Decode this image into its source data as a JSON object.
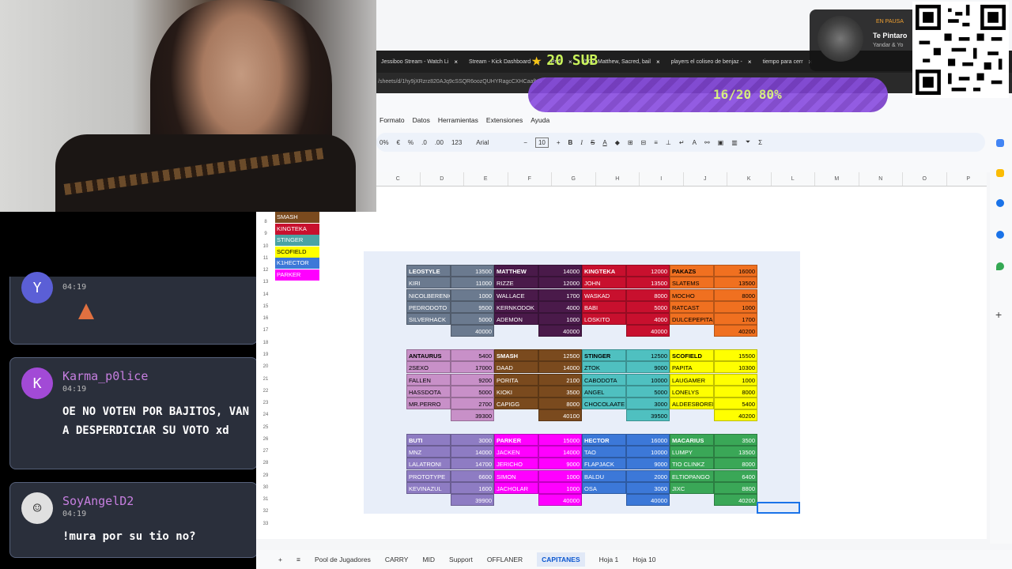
{
  "browser": {
    "tabs": [
      {
        "label": "Jessiboo Stream - Watch Li"
      },
      {
        "label": "Stream - Kick Dashboard"
      },
      {
        "label": "Pro -"
      },
      {
        "label": "(502) Matthew, Sacred, bail"
      },
      {
        "label": "players el coliseo de benjaz -"
      },
      {
        "label": "tiempo para cerr"
      }
    ],
    "url": "/sheets/d/1hy9jXRzrz820AJq9cSSQR6oozQUHYRagcCXHCaafH5"
  },
  "overlay": {
    "sub_goal_label": "20 SUB",
    "sub_progress_text": "16/20 80%",
    "sub_progress": 0.8,
    "music_status": "EN PAUSA",
    "music_title": "Te Pintaro",
    "music_artist": "Yandar & Yo"
  },
  "sheets": {
    "menu": [
      "Formato",
      "Datos",
      "Herramientas",
      "Extensiones",
      "Ayuda"
    ],
    "toolbar": {
      "zoom": "0%",
      "currency": "€",
      "percent": "%",
      "format_123": "123",
      "font": "Arial",
      "font_size": "10"
    },
    "columns": [
      "C",
      "D",
      "E",
      "F",
      "G",
      "H",
      "I",
      "J",
      "K",
      "L",
      "M",
      "N",
      "O",
      "P"
    ],
    "row_numbers": [
      "8",
      "9",
      "10",
      "11",
      "12",
      "13",
      "14",
      "15",
      "16",
      "17",
      "18",
      "19",
      "20",
      "21",
      "22",
      "23",
      "24",
      "25",
      "26",
      "27",
      "28",
      "29",
      "30",
      "31",
      "32",
      "33"
    ],
    "legend": [
      {
        "label": "SMASH",
        "color": "#7a4a1e"
      },
      {
        "label": "KINGTEKA",
        "color": "#c8102e"
      },
      {
        "label": "STINGER",
        "color": "#4aa3a3"
      },
      {
        "label": "SCOFIELD",
        "color": "#ffff00"
      },
      {
        "label": "K1HECTOR",
        "color": "#3c78d8"
      },
      {
        "label": "PARKER",
        "color": "#ff00ff"
      }
    ],
    "teams": [
      {
        "captain": "LEOSTYLE",
        "captain_value": "13500",
        "color": "#6b7a8f",
        "players": [
          [
            "KIRI",
            "11000"
          ],
          [
            "NICOLBERENIC",
            "1000"
          ],
          [
            "PEDRODOTO",
            "9500"
          ],
          [
            "SILVERHACK",
            "5000"
          ]
        ],
        "total": "40000"
      },
      {
        "captain": "MATTHEW",
        "captain_value": "14000",
        "color": "#4a1a4a",
        "players": [
          [
            "RIZZE",
            "12000"
          ],
          [
            "WALLACE",
            "1700"
          ],
          [
            "KERNKODOK",
            "4000"
          ],
          [
            "ADEMON",
            "1000"
          ]
        ],
        "total": "40000"
      },
      {
        "captain": "KINGTEKA",
        "captain_value": "12000",
        "color": "#c8102e",
        "players": [
          [
            "JOHN",
            "13500"
          ],
          [
            "WASKAD",
            "8000"
          ],
          [
            "BABI",
            "5000"
          ],
          [
            "LOSKITO",
            "4000"
          ]
        ],
        "total": "40000"
      },
      {
        "captain": "PAKAZS",
        "captain_value": "16000",
        "color": "#f07020",
        "players": [
          [
            "SLATEMS",
            "13500"
          ],
          [
            "MOCHO",
            "8000"
          ],
          [
            "RATCAST",
            "1000"
          ],
          [
            "DULCEPEPITA",
            "1700"
          ]
        ],
        "total": "40200"
      },
      {
        "captain": "ANTAURUS",
        "captain_value": "5400",
        "color": "#c890c8",
        "players": [
          [
            "2SEXO",
            "17000"
          ],
          [
            "FALLEN",
            "9200"
          ],
          [
            "HASSDOTA",
            "5000"
          ],
          [
            "MR.PERRO",
            "2700"
          ]
        ],
        "total": "39300"
      },
      {
        "captain": "SMASH",
        "captain_value": "12500",
        "color": "#7a4a1e",
        "players": [
          [
            "DAAD",
            "14000"
          ],
          [
            "PORITA",
            "2100"
          ],
          [
            "KIOKI",
            "3500"
          ],
          [
            "CAPIGG",
            "8000"
          ]
        ],
        "total": "40100"
      },
      {
        "captain": "STINGER",
        "captain_value": "12500",
        "color": "#4fc0c0",
        "players": [
          [
            "ZTOK",
            "9000"
          ],
          [
            "CABODOTA",
            "10000"
          ],
          [
            "ANGEL",
            "5000"
          ],
          [
            "CHOCOLAATE",
            "3000"
          ]
        ],
        "total": "39500"
      },
      {
        "captain": "SCOFIELD",
        "captain_value": "15500",
        "color": "#ffff00",
        "players": [
          [
            "PAPITA",
            "10300"
          ],
          [
            "LAUGAMER",
            "1000"
          ],
          [
            "LONELYS",
            "8000"
          ],
          [
            "ALDEESBORED",
            "5400"
          ]
        ],
        "total": "40200"
      },
      {
        "captain": "BUTI",
        "captain_value": "3000",
        "color": "#8e7cc3",
        "players": [
          [
            "MNZ",
            "14000"
          ],
          [
            "LALATRONI",
            "14700"
          ],
          [
            "PROTOTYPE",
            "6600"
          ],
          [
            "KEVINAZUL",
            "1600"
          ]
        ],
        "total": "39900"
      },
      {
        "captain": "PARKER",
        "captain_value": "15000",
        "color": "#ff00ff",
        "players": [
          [
            "JACKEN",
            "14000"
          ],
          [
            "JERICHO",
            "9000"
          ],
          [
            "SIMON",
            "1000"
          ],
          [
            "JACHOLAR",
            "1000"
          ]
        ],
        "total": "40000"
      },
      {
        "captain": "HECTOR",
        "captain_value": "16000",
        "color": "#3c78d8",
        "players": [
          [
            "TAO",
            "10000"
          ],
          [
            "FLAPJACK",
            "9000"
          ],
          [
            "BALDU",
            "2000"
          ],
          [
            "OSA",
            "3000"
          ]
        ],
        "total": "40000"
      },
      {
        "captain": "MACARIUS",
        "captain_value": "3500",
        "color": "#3aa757",
        "players": [
          [
            "LUMPY",
            "13500"
          ],
          [
            "TIO CLINKZ",
            "8000"
          ],
          [
            "ELTIOPANGO",
            "6400"
          ],
          [
            "JIXC",
            "8800"
          ]
        ],
        "total": "40200"
      }
    ],
    "sheet_tabs": [
      "Pool de Jugadores",
      "CARRY",
      "MID",
      "Support",
      "OFFLANER",
      "CAPITANES",
      "Hoja 1",
      "Hoja 10"
    ],
    "active_tab": "CAPITANES"
  },
  "chat": [
    {
      "user": "",
      "initial": "Y",
      "time": "04:19",
      "message": "",
      "avatar_color": "#5b5fd6"
    },
    {
      "user": "Karma_p0lice",
      "initial": "K",
      "time": "04:19",
      "message": "OE NO VOTEN POR BAJITOS, VAN A DESPERDICIAR SU VOTO xd",
      "avatar_color": "#a24ad6"
    },
    {
      "user": "SoyAngelD2",
      "initial": "",
      "time": "04:19",
      "message": "!mura por su tio no?",
      "avatar_color": "#e0e0e0"
    }
  ]
}
